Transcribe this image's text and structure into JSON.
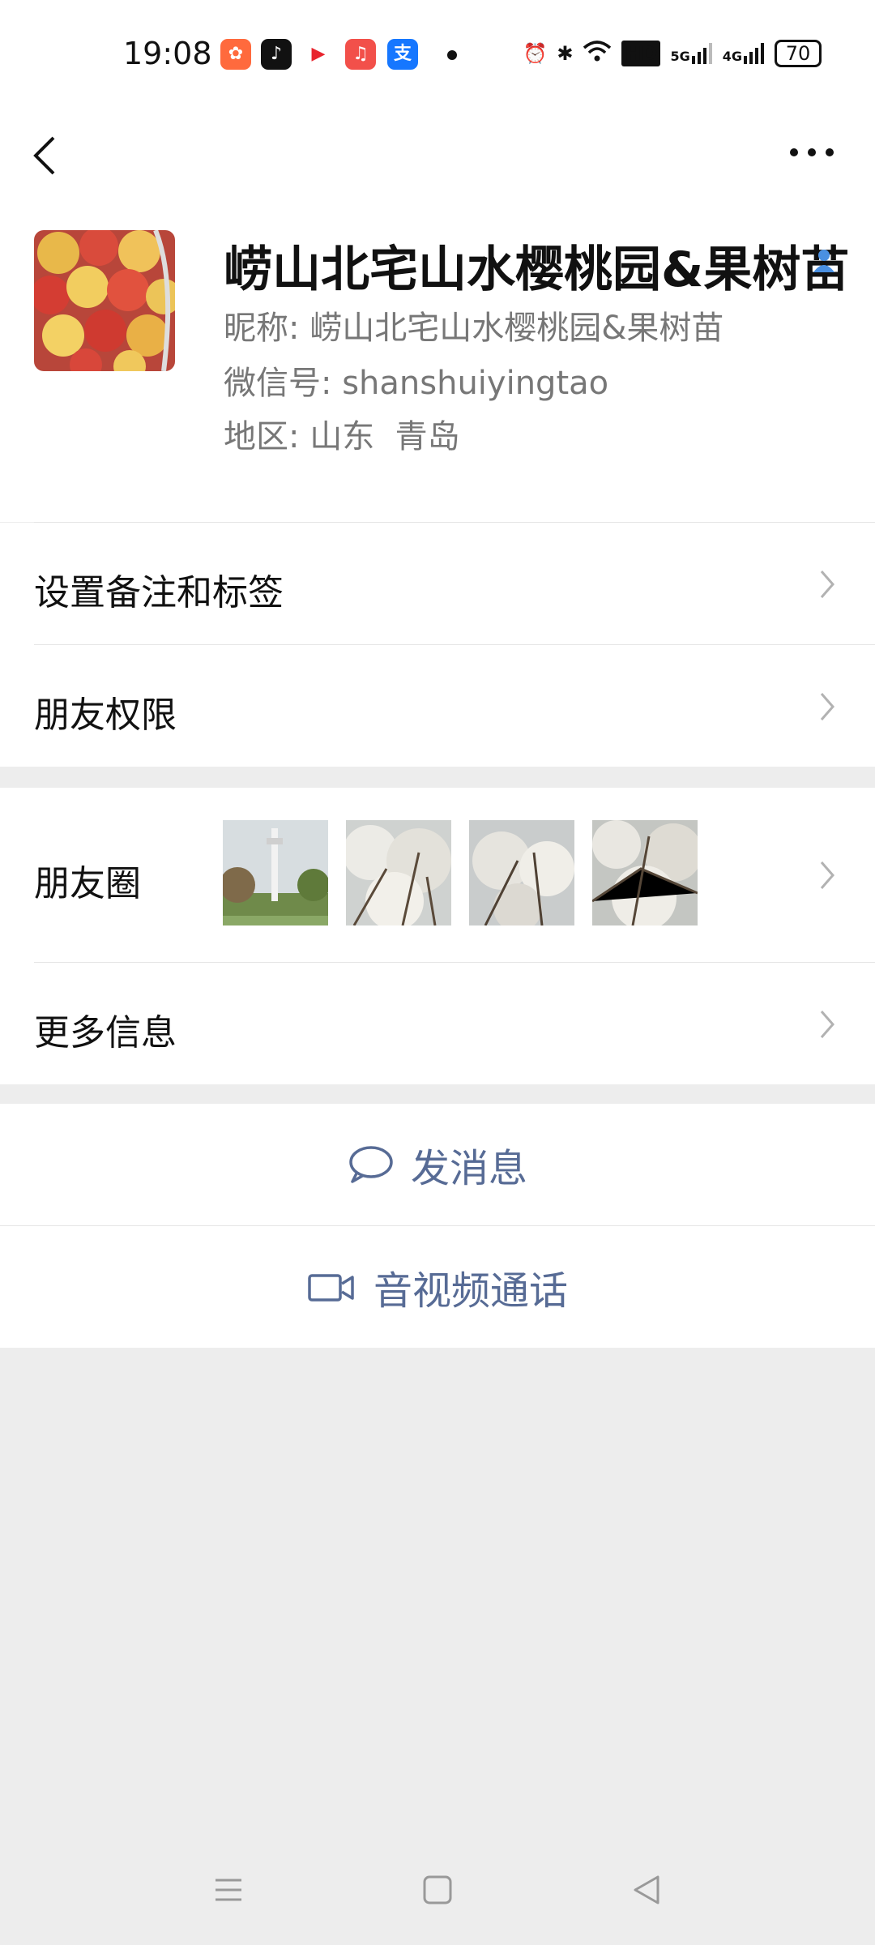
{
  "status_bar": {
    "time": "19:08",
    "icons": [
      "kuaishou-icon",
      "tiktok-icon",
      "video-icon",
      "music-icon",
      "alipay-icon"
    ],
    "hd_label": "HD",
    "net1": "5G",
    "net2": "4G",
    "battery": "70"
  },
  "profile": {
    "display_name": "崂山北宅山水樱桃园&果树苗",
    "nickname_label": "昵称:",
    "nickname": "崂山北宅山水樱桃园&果树苗",
    "wechat_id_label": "微信号:",
    "wechat_id": "shanshuiyingtao",
    "region_label": "地区:",
    "region": "山东  青岛"
  },
  "menu": {
    "set_remark": "设置备注和标签",
    "permissions": "朋友权限",
    "moments": "朋友圈",
    "more_info": "更多信息"
  },
  "actions": {
    "send_message": "发消息",
    "call": "音视频通话"
  },
  "colors": {
    "accent": "#576b95",
    "background": "#ededed",
    "verify": "#4a90e2"
  }
}
